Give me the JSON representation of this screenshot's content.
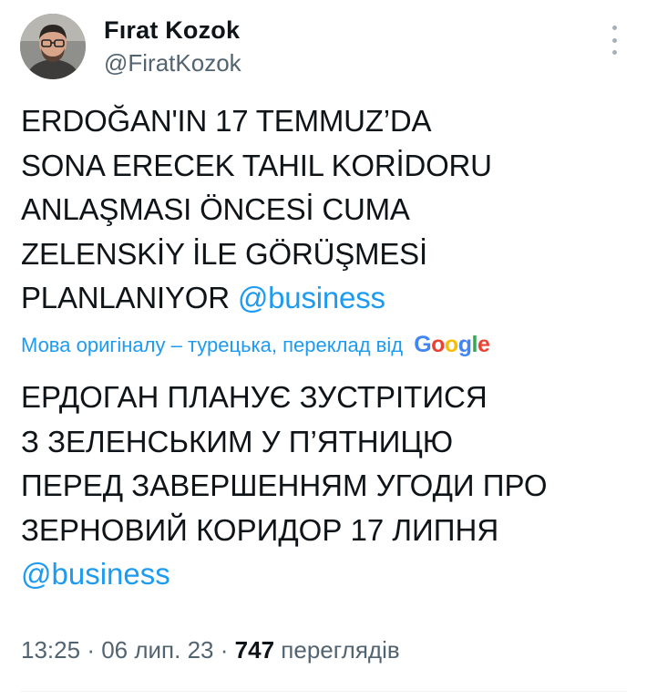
{
  "author": {
    "name": "Fırat Kozok",
    "handle": "@FiratKozok"
  },
  "tweet": {
    "text_lines": [
      "ERDOĞAN'IN 17 TEMMUZ’DA",
      "SONA ERECEK TAHIL KORİDORU",
      "ANLAŞMASI ÖNCESİ CUMA",
      "ZELENSKİY İLE GÖRÜŞMESİ",
      "PLANLANIYOR"
    ],
    "mention": "@business"
  },
  "translation": {
    "note": "Мова оригіналу – турецька, переклад від",
    "provider_letters": [
      "G",
      "o",
      "o",
      "g",
      "l",
      "e"
    ],
    "text_lines": [
      "ЕРДОГАН ПЛАНУЄ ЗУСТРІТИСЯ",
      "З ЗЕЛЕНСЬКИМ У П’ЯТНИЦЮ",
      "ПЕРЕД ЗАВЕРШЕННЯМ УГОДИ ПРО",
      "ЗЕРНОВИЙ КОРИДОР 17 ЛИПНЯ"
    ],
    "mention": "@business"
  },
  "meta": {
    "time": "13:25",
    "separator": "·",
    "date": "06 лип. 23",
    "views_count": "747",
    "views_label": "переглядів"
  },
  "colors": {
    "accent": "#1d9bf0",
    "secondary_text": "#536471",
    "primary_text": "#0f1419"
  },
  "icons": {
    "more": "more-vertical-icon",
    "avatar": "user-avatar"
  }
}
